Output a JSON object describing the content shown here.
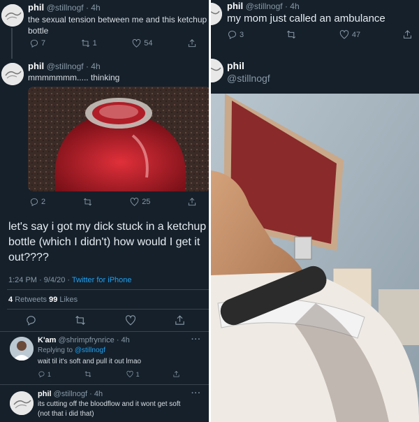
{
  "left": {
    "tweet1": {
      "name": "phil",
      "meta": "@stillnogf · 4h",
      "text_line1": "the sexual tension between me and this ketchup",
      "text_line2": "bottle",
      "replies": "7",
      "retweets": "1",
      "likes": "54"
    },
    "tweet2": {
      "name": "phil",
      "meta": "@stillnogf · 4h",
      "text": "mmmmmmm..... thinking",
      "replies": "2",
      "likes": "25"
    },
    "main": {
      "text_line1": "let's say i got my dick stuck in a ketchup",
      "text_line2": "bottle (which I didn't) how would I get it",
      "text_line3": "out????",
      "time": "1:24 PM · 9/4/20 · ",
      "source": "Twitter for iPhone",
      "retweet_count": "4",
      "retweet_label": "Retweets",
      "like_count": "99",
      "like_label": "Likes"
    },
    "reply1": {
      "name": "K'am",
      "meta": "@shrimpfrynrice · 4h",
      "replying_prefix": "Replying to ",
      "replying_handle": "@stillnogf",
      "text": "wait til it's soft and pull it out lmao",
      "replies": "1",
      "likes": "1",
      "more": "···"
    },
    "reply2": {
      "name": "phil",
      "meta": "@stillnogf · 4h",
      "text_line1": "its cutting off the bloodflow and it wont get soft",
      "text_line2": "(not that i did that)",
      "more": "···"
    }
  },
  "right": {
    "tweet": {
      "name": "phil",
      "meta": "@stillnogf · 4h",
      "text": "my mom just called an ambulance",
      "replies": "3",
      "likes": "47"
    },
    "author": {
      "name": "phil",
      "handle": "@stillnogf"
    }
  },
  "colors": {
    "background": "#15202b",
    "text": "#d9dde1",
    "muted": "#8899a6",
    "link": "#1da1f2",
    "divider": "#38444d"
  },
  "icons": [
    "reply-icon",
    "retweet-icon",
    "like-icon",
    "share-icon",
    "more-icon"
  ]
}
